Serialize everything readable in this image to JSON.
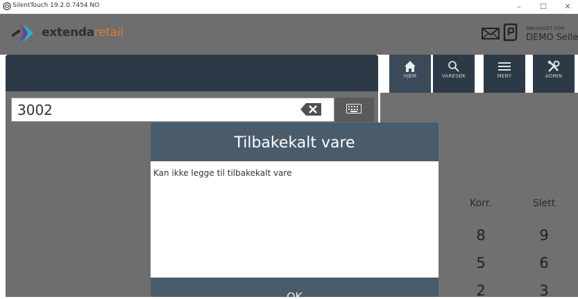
{
  "window": {
    "title": "SilentTouch 19.2.0.7454 NO",
    "minimize": "–",
    "maximize": "☐",
    "close": "✕"
  },
  "header": {
    "logo_bold": "extenda",
    "logo_light": "retail",
    "login_label": "INNLOGGET SOM",
    "login_user": "DEMO Seller"
  },
  "nav": {
    "home": "HJEM",
    "search": "VARESØK",
    "menu": "MENY",
    "admin": "ADMIN"
  },
  "input": {
    "value": "3002"
  },
  "keypad": {
    "corr": "Korr.",
    "delete": "Slett",
    "keys": [
      "8",
      "9",
      "5",
      "6",
      "2",
      "3"
    ]
  },
  "modal": {
    "title": "Tilbakekalt vare",
    "message": "Kan ikke legge til tilbakekalt vare",
    "ok_label": "OK"
  },
  "colors": {
    "header_bg": "#6e6e6e",
    "nav_bg": "#2c3a47",
    "modal_header": "#4a5c6a",
    "accent_orange": "#e07a2b"
  }
}
